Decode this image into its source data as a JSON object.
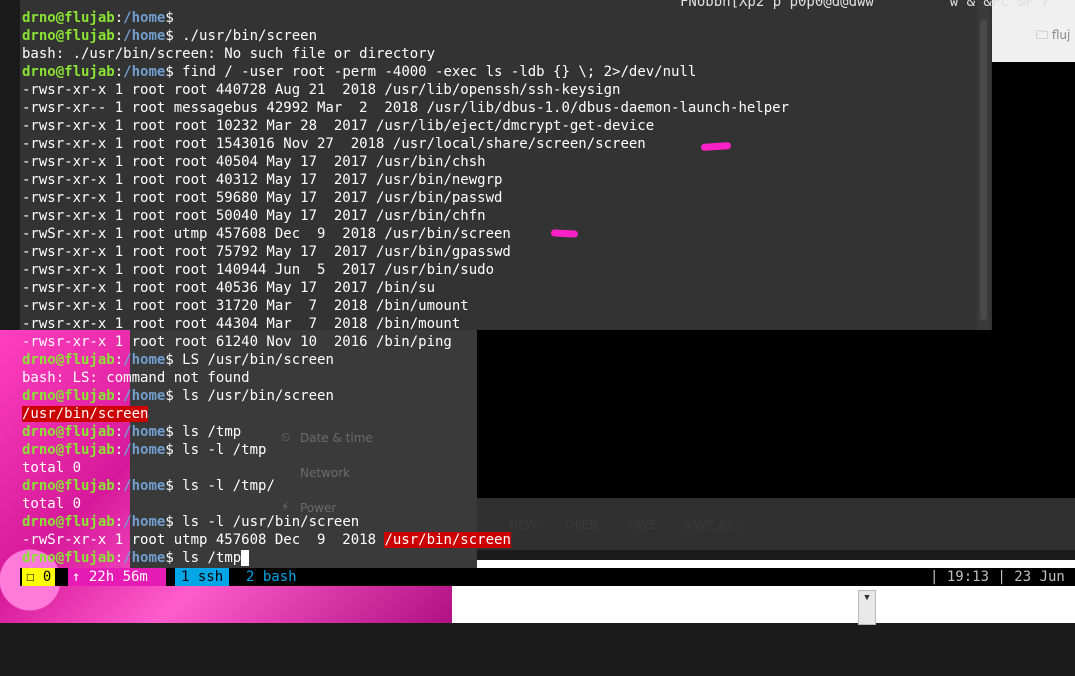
{
  "terminal": {
    "garbled_line": "FNobbh[Xp2 p p0p0@d@dww         w & &PC &P P",
    "lines": [
      {
        "segs": [
          {
            "t": "drno@flujab",
            "c": "user"
          },
          {
            "t": ":",
            "c": ""
          },
          {
            "t": "/home",
            "c": "path"
          },
          {
            "t": "$ ",
            "c": ""
          }
        ]
      },
      {
        "segs": [
          {
            "t": "drno@flujab",
            "c": "user"
          },
          {
            "t": ":",
            "c": ""
          },
          {
            "t": "/home",
            "c": "path"
          },
          {
            "t": "$ ./usr/bin/screen",
            "c": ""
          }
        ]
      },
      {
        "segs": [
          {
            "t": "bash: ./usr/bin/screen: No such file or directory",
            "c": ""
          }
        ]
      },
      {
        "segs": [
          {
            "t": "drno@flujab",
            "c": "user"
          },
          {
            "t": ":",
            "c": ""
          },
          {
            "t": "/home",
            "c": "path"
          },
          {
            "t": "$ find / -user root -perm -4000 -exec ls -ldb {} \\; 2>/dev/null",
            "c": ""
          }
        ]
      },
      {
        "segs": [
          {
            "t": "-rwsr-xr-x 1 root root 440728 Aug 21  2018 /usr/lib/openssh/ssh-keysign",
            "c": ""
          }
        ]
      },
      {
        "segs": [
          {
            "t": "-rwsr-xr-- 1 root messagebus 42992 Mar  2  2018 /usr/lib/dbus-1.0/dbus-daemon-launch-helper",
            "c": ""
          }
        ]
      },
      {
        "segs": [
          {
            "t": "-rwsr-xr-x 1 root root 10232 Mar 28  2017 /usr/lib/eject/dmcrypt-get-device",
            "c": ""
          }
        ]
      },
      {
        "segs": [
          {
            "t": "-rwsr-xr-x 1 root root 1543016 Nov 27  2018 /usr/local/share/screen/screen",
            "c": ""
          }
        ]
      },
      {
        "segs": [
          {
            "t": "-rwsr-xr-x 1 root root 40504 May 17  2017 /usr/bin/chsh",
            "c": ""
          }
        ]
      },
      {
        "segs": [
          {
            "t": "-rwsr-xr-x 1 root root 40312 May 17  2017 /usr/bin/newgrp",
            "c": ""
          }
        ]
      },
      {
        "segs": [
          {
            "t": "-rwsr-xr-x 1 root root 59680 May 17  2017 /usr/bin/passwd",
            "c": ""
          }
        ]
      },
      {
        "segs": [
          {
            "t": "-rwsr-xr-x 1 root root 50040 May 17  2017 /usr/bin/chfn",
            "c": ""
          }
        ]
      },
      {
        "segs": [
          {
            "t": "-rwSr-xr-x 1 root utmp 457608 Dec  9  2018 /usr/bin/screen",
            "c": ""
          }
        ]
      },
      {
        "segs": [
          {
            "t": "-rwsr-xr-x 1 root root 75792 May 17  2017 /usr/bin/gpasswd",
            "c": ""
          }
        ]
      },
      {
        "segs": [
          {
            "t": "-rwsr-xr-x 1 root root 140944 Jun  5  2017 /usr/bin/sudo",
            "c": ""
          }
        ]
      },
      {
        "segs": [
          {
            "t": "-rwsr-xr-x 1 root root 40536 May 17  2017 /bin/su",
            "c": ""
          }
        ]
      },
      {
        "segs": [
          {
            "t": "-rwsr-xr-x 1 root root 31720 Mar  7  2018 /bin/umount",
            "c": ""
          }
        ]
      },
      {
        "segs": [
          {
            "t": "-rwsr-xr-x 1 root root 44304 Mar  7  2018 /bin/mount",
            "c": ""
          }
        ]
      },
      {
        "segs": [
          {
            "t": "-rwsr-xr-x 1 root root 61240 Nov 10  2016 /bin/ping",
            "c": ""
          }
        ]
      },
      {
        "segs": [
          {
            "t": "drno@flujab",
            "c": "user"
          },
          {
            "t": ":",
            "c": ""
          },
          {
            "t": "/home",
            "c": "path"
          },
          {
            "t": "$ LS /usr/bin/screen",
            "c": ""
          }
        ]
      },
      {
        "segs": [
          {
            "t": "bash: LS: command not found",
            "c": ""
          }
        ]
      },
      {
        "segs": [
          {
            "t": "drno@flujab",
            "c": "user"
          },
          {
            "t": ":",
            "c": ""
          },
          {
            "t": "/home",
            "c": "path"
          },
          {
            "t": "$ ls /usr/bin/screen",
            "c": ""
          }
        ]
      },
      {
        "segs": [
          {
            "t": "/usr/bin/screen",
            "c": "hl"
          }
        ]
      },
      {
        "segs": [
          {
            "t": "drno@flujab",
            "c": "user"
          },
          {
            "t": ":",
            "c": ""
          },
          {
            "t": "/home",
            "c": "path"
          },
          {
            "t": "$ ls /tmp",
            "c": ""
          }
        ]
      },
      {
        "segs": [
          {
            "t": "drno@flujab",
            "c": "user"
          },
          {
            "t": ":",
            "c": ""
          },
          {
            "t": "/home",
            "c": "path"
          },
          {
            "t": "$ ls -l /tmp",
            "c": ""
          }
        ]
      },
      {
        "segs": [
          {
            "t": "total 0",
            "c": ""
          }
        ]
      },
      {
        "segs": [
          {
            "t": "drno@flujab",
            "c": "user"
          },
          {
            "t": ":",
            "c": ""
          },
          {
            "t": "/home",
            "c": "path"
          },
          {
            "t": "$ ls -l /tmp/",
            "c": ""
          }
        ]
      },
      {
        "segs": [
          {
            "t": "total 0",
            "c": ""
          }
        ]
      },
      {
        "segs": [
          {
            "t": "drno@flujab",
            "c": "user"
          },
          {
            "t": ":",
            "c": ""
          },
          {
            "t": "/home",
            "c": "path"
          },
          {
            "t": "$ ls -l /usr/bin/screen",
            "c": ""
          }
        ]
      },
      {
        "segs": [
          {
            "t": "-rwSr-xr-x 1 root utmp 457608 Dec  9  2018 ",
            "c": ""
          },
          {
            "t": "/usr/bin/screen",
            "c": "hl"
          }
        ]
      },
      {
        "segs": [
          {
            "t": "drno@flujab",
            "c": "user"
          },
          {
            "t": ":",
            "c": ""
          },
          {
            "t": "/home",
            "c": "path"
          },
          {
            "t": "$ ls /tmp",
            "c": ""
          },
          {
            "t": "",
            "c": "cursor"
          }
        ]
      }
    ]
  },
  "status_bar": {
    "window0": "☐ 0",
    "uptime": "↑ 22h 56m",
    "window1": "1 ssh",
    "window2": "2 bash",
    "clock": "| 19:13 | 23 Jun"
  },
  "background": {
    "window_tab": "🗀 fluj",
    "settings_items": [
      "Date & time",
      "Network",
      "Power"
    ],
    "settings_icons": [
      "⏲",
      "",
      "⚡"
    ],
    "editor_buttons": [
      "NEW",
      "OPEN",
      "SAVE",
      "SAVE AS..."
    ],
    "scroll_down": "▼"
  },
  "colors": {
    "user": "#8ae234",
    "path": "#729fcf",
    "highlight": "#cc0000",
    "marker": "#ff20c8"
  }
}
